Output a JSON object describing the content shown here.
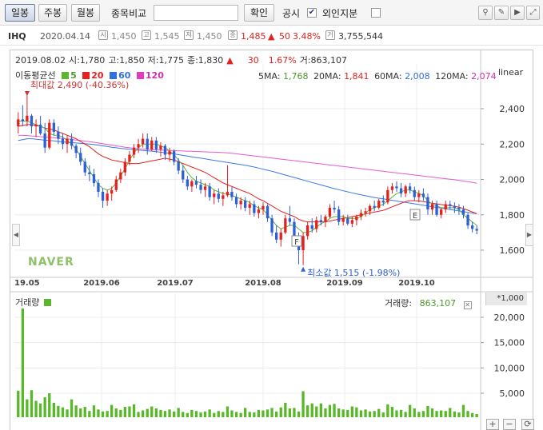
{
  "toolbar": {
    "period_buttons": [
      "일봉",
      "주봉",
      "월봉"
    ],
    "compare_label": "종목비교",
    "compare_input_value": "",
    "confirm_label": "확인",
    "disclosure_label": "공시",
    "disclosure_checked": "✔",
    "foreign_label": "외인지분",
    "icons": [
      "pin-icon",
      "pencil-icon",
      "cursor-icon",
      "expand-icon"
    ]
  },
  "info": {
    "ticker": "IHQ",
    "date": "2020.04.14",
    "open_label": "시",
    "open": "1,450",
    "high_label": "고",
    "high": "1,545",
    "low_label": "저",
    "low": "1,450",
    "close_label": "종",
    "close": "1,485",
    "change_arrow": "▲",
    "change": "50",
    "change_pct": "3.48%",
    "volume_label": "거",
    "volume": "3,755,544"
  },
  "chart": {
    "ohlc": {
      "date": "2019.08.02",
      "open": "시:1,780",
      "high": "고:1,850",
      "low": "저:1,775",
      "close": "종:1,830",
      "arrow": "▲",
      "change": "30",
      "pct": "1.67%",
      "volume": "거:863,107"
    },
    "legend_title": "이동평균선",
    "legend": [
      {
        "label": "5",
        "color": "#5cb531"
      },
      {
        "label": "20",
        "color": "#e5201f"
      },
      {
        "label": "60",
        "color": "#2f6fe0"
      },
      {
        "label": "120",
        "color": "#e03cc0"
      }
    ],
    "ma_info": [
      {
        "label": "5MA:",
        "value": "1,768",
        "color": "#4a9a2a"
      },
      {
        "label": "20MA:",
        "value": "1,841",
        "color": "#e5201f"
      },
      {
        "label": "60MA:",
        "value": "2,008",
        "color": "#2f6fe0"
      },
      {
        "label": "120MA:",
        "value": "2,074",
        "color": "#d02fb0"
      }
    ],
    "scale_label": "linear",
    "max_note": "최대값 2,490 (-40.36%)",
    "min_note": "최소값 1,515 (-1.98%)",
    "watermark": "NAVER",
    "marker_f": "F",
    "marker_e": "E",
    "y_ticks": [
      "2,400",
      "2,200",
      "2,000",
      "1,800",
      "1,600"
    ],
    "x_ticks": [
      "19.05",
      "2019.06",
      "2019.07",
      "2019.08",
      "2019.09",
      "2019.10"
    ],
    "volume_label": "거래량",
    "volume_value_label": "거래량:",
    "volume_value": "863,107",
    "volume_unit": "*1,000",
    "volume_ticks": [
      "20,000",
      "15,000",
      "10,000",
      "5,000"
    ]
  },
  "chart_data": {
    "type": "candlestick",
    "y_range": [
      1515,
      2490
    ],
    "candles": [
      [
        2300,
        2380,
        2260,
        2340
      ],
      [
        2340,
        2420,
        2300,
        2330
      ],
      [
        2330,
        2490,
        2300,
        2360
      ],
      [
        2360,
        2370,
        2260,
        2300
      ],
      [
        2300,
        2340,
        2240,
        2310
      ],
      [
        2310,
        2360,
        2250,
        2260
      ],
      [
        2260,
        2320,
        2150,
        2180
      ],
      [
        2180,
        2340,
        2170,
        2320
      ],
      [
        2320,
        2340,
        2250,
        2270
      ],
      [
        2270,
        2300,
        2200,
        2230
      ],
      [
        2230,
        2260,
        2170,
        2200
      ],
      [
        2200,
        2250,
        2150,
        2230
      ],
      [
        2230,
        2260,
        2170,
        2190
      ],
      [
        2190,
        2200,
        2120,
        2150
      ],
      [
        2150,
        2180,
        2080,
        2100
      ],
      [
        2100,
        2120,
        2020,
        2040
      ],
      [
        2040,
        2080,
        1990,
        2030
      ],
      [
        2030,
        2060,
        1960,
        1980
      ],
      [
        1980,
        2000,
        1900,
        1930
      ],
      [
        1930,
        1950,
        1840,
        1880
      ],
      [
        1880,
        1940,
        1850,
        1920
      ],
      [
        1920,
        1960,
        1880,
        1940
      ],
      [
        1940,
        2020,
        1930,
        2000
      ],
      [
        2000,
        2060,
        1980,
        2040
      ],
      [
        2040,
        2120,
        2020,
        2100
      ],
      [
        2100,
        2160,
        2080,
        2140
      ],
      [
        2140,
        2200,
        2120,
        2180
      ],
      [
        2180,
        2230,
        2150,
        2200
      ],
      [
        2200,
        2260,
        2180,
        2230
      ],
      [
        2230,
        2260,
        2140,
        2170
      ],
      [
        2170,
        2240,
        2160,
        2220
      ],
      [
        2220,
        2240,
        2150,
        2170
      ],
      [
        2170,
        2210,
        2130,
        2190
      ],
      [
        2190,
        2200,
        2110,
        2140
      ],
      [
        2140,
        2180,
        2100,
        2160
      ],
      [
        2160,
        2170,
        2080,
        2100
      ],
      [
        2100,
        2120,
        2030,
        2050
      ],
      [
        2050,
        2080,
        1980,
        2000
      ],
      [
        2000,
        2020,
        1940,
        1960
      ],
      [
        1960,
        2000,
        1930,
        1990
      ],
      [
        1990,
        2020,
        1950,
        1970
      ],
      [
        1970,
        2000,
        1920,
        1940
      ],
      [
        1940,
        1980,
        1900,
        1960
      ],
      [
        1960,
        1980,
        1880,
        1900
      ],
      [
        1900,
        1940,
        1860,
        1920
      ],
      [
        1920,
        1950,
        1870,
        1890
      ],
      [
        1890,
        1930,
        1850,
        1910
      ],
      [
        1910,
        2080,
        1900,
        1930
      ],
      [
        1930,
        1960,
        1880,
        1900
      ],
      [
        1900,
        1920,
        1840,
        1860
      ],
      [
        1860,
        1900,
        1830,
        1880
      ],
      [
        1880,
        1900,
        1820,
        1840
      ],
      [
        1840,
        1880,
        1800,
        1860
      ],
      [
        1860,
        1880,
        1790,
        1810
      ],
      [
        1810,
        1850,
        1780,
        1830
      ],
      [
        1830,
        1870,
        1800,
        1850
      ],
      [
        1850,
        1860,
        1760,
        1780
      ],
      [
        1780,
        1800,
        1680,
        1700
      ],
      [
        1700,
        1740,
        1640,
        1660
      ],
      [
        1660,
        1720,
        1620,
        1700
      ],
      [
        1700,
        1800,
        1690,
        1780
      ],
      [
        1780,
        1850,
        1740,
        1760
      ],
      [
        1760,
        1780,
        1640,
        1660
      ],
      [
        1660,
        1700,
        1520,
        1600
      ],
      [
        1600,
        1700,
        1515,
        1680
      ],
      [
        1680,
        1760,
        1660,
        1740
      ],
      [
        1740,
        1780,
        1700,
        1720
      ],
      [
        1720,
        1790,
        1700,
        1770
      ],
      [
        1770,
        1800,
        1740,
        1760
      ],
      [
        1760,
        1800,
        1730,
        1790
      ],
      [
        1790,
        1860,
        1780,
        1840
      ],
      [
        1840,
        1880,
        1810,
        1830
      ],
      [
        1830,
        1850,
        1740,
        1760
      ],
      [
        1760,
        1800,
        1740,
        1780
      ],
      [
        1780,
        1800,
        1740,
        1750
      ],
      [
        1750,
        1790,
        1730,
        1770
      ],
      [
        1770,
        1800,
        1740,
        1790
      ],
      [
        1790,
        1830,
        1770,
        1810
      ],
      [
        1810,
        1840,
        1790,
        1820
      ],
      [
        1820,
        1860,
        1800,
        1850
      ],
      [
        1850,
        1880,
        1820,
        1840
      ],
      [
        1840,
        1890,
        1830,
        1880
      ],
      [
        1880,
        1910,
        1850,
        1870
      ],
      [
        1870,
        1960,
        1860,
        1940
      ],
      [
        1940,
        1980,
        1920,
        1960
      ],
      [
        1960,
        1990,
        1930,
        1950
      ],
      [
        1950,
        1980,
        1900,
        1920
      ],
      [
        1920,
        1970,
        1900,
        1960
      ],
      [
        1960,
        1980,
        1920,
        1940
      ],
      [
        1940,
        1960,
        1880,
        1900
      ],
      [
        1900,
        1940,
        1870,
        1920
      ],
      [
        1920,
        1950,
        1880,
        1900
      ],
      [
        1900,
        1920,
        1800,
        1830
      ],
      [
        1830,
        1880,
        1800,
        1860
      ],
      [
        1860,
        1880,
        1790,
        1800
      ],
      [
        1800,
        1840,
        1780,
        1830
      ],
      [
        1830,
        1880,
        1810,
        1860
      ],
      [
        1860,
        1880,
        1830,
        1850
      ],
      [
        1850,
        1870,
        1810,
        1840
      ],
      [
        1840,
        1860,
        1800,
        1830
      ],
      [
        1830,
        1850,
        1780,
        1800
      ],
      [
        1800,
        1810,
        1720,
        1740
      ],
      [
        1740,
        1760,
        1700,
        1720
      ],
      [
        1720,
        1740,
        1690,
        1710
      ]
    ],
    "ma5": [
      2330,
      2330,
      2330,
      2320,
      2310,
      2300,
      2290,
      2260,
      2250,
      2250,
      2240,
      2220,
      2200,
      2170,
      2130,
      2090,
      2050,
      2010,
      1970,
      1950,
      1940,
      1950,
      1980,
      2020,
      2060,
      2110,
      2150,
      2180,
      2200,
      2200,
      2200,
      2200,
      2190,
      2180,
      2160,
      2140,
      2110,
      2080,
      2040,
      2010,
      1990,
      1980,
      1970,
      1960,
      1940,
      1930,
      1920,
      1920,
      1910,
      1900,
      1890,
      1880,
      1870,
      1850,
      1840,
      1830,
      1800,
      1770,
      1740,
      1720,
      1730,
      1740,
      1740,
      1720,
      1700,
      1700,
      1710,
      1730,
      1750,
      1760,
      1780,
      1790,
      1790,
      1790,
      1780,
      1780,
      1780,
      1790,
      1810,
      1830,
      1840,
      1850,
      1860,
      1880,
      1900,
      1920,
      1930,
      1940,
      1940,
      1930,
      1920,
      1910,
      1880,
      1860,
      1850,
      1840,
      1840,
      1840,
      1840,
      1830,
      1800,
      1780,
      1760,
      1740
    ],
    "ma20": [
      2300,
      2305,
      2310,
      2310,
      2305,
      2300,
      2290,
      2285,
      2280,
      2270,
      2260,
      2250,
      2240,
      2230,
      2215,
      2200,
      2185,
      2165,
      2145,
      2130,
      2120,
      2110,
      2105,
      2100,
      2095,
      2090,
      2090,
      2090,
      2095,
      2100,
      2105,
      2110,
      2115,
      2120,
      2115,
      2110,
      2100,
      2090,
      2080,
      2070,
      2060,
      2050,
      2040,
      2025,
      2010,
      1995,
      1980,
      1970,
      1960,
      1950,
      1940,
      1930,
      1920,
      1905,
      1890,
      1880,
      1865,
      1850,
      1835,
      1820,
      1810,
      1800,
      1790,
      1775,
      1765,
      1760,
      1760,
      1760,
      1760,
      1760,
      1765,
      1770,
      1775,
      1780,
      1785,
      1790,
      1795,
      1800,
      1805,
      1810,
      1815,
      1820,
      1825,
      1835,
      1845,
      1855,
      1865,
      1875,
      1880,
      1880,
      1878,
      1875,
      1870,
      1865,
      1862,
      1858,
      1855,
      1852,
      1848,
      1843,
      1835,
      1826,
      1816,
      1806
    ],
    "ma60": [
      2220,
      2225,
      2230,
      2230,
      2228,
      2225,
      2222,
      2220,
      2218,
      2215,
      2212,
      2210,
      2208,
      2206,
      2204,
      2202,
      2200,
      2197,
      2194,
      2190,
      2186,
      2182,
      2179,
      2176,
      2173,
      2170,
      2168,
      2166,
      2164,
      2162,
      2160,
      2157,
      2154,
      2151,
      2148,
      2144,
      2140,
      2136,
      2132,
      2128,
      2124,
      2120,
      2116,
      2112,
      2108,
      2104,
      2100,
      2096,
      2092,
      2088,
      2084,
      2080,
      2075,
      2070,
      2064,
      2058,
      2052,
      2046,
      2039,
      2032,
      2025,
      2018,
      2011,
      2004,
      1997,
      1990,
      1983,
      1976,
      1969,
      1962,
      1955,
      1948,
      1942,
      1936,
      1930,
      1924,
      1918,
      1913,
      1908,
      1903,
      1898,
      1894,
      1890,
      1886,
      1882,
      1878,
      1874,
      1870,
      1866,
      1862,
      1858,
      1854,
      1850,
      1846,
      1842,
      1838,
      1834,
      1830,
      1826,
      1822,
      1818,
      1814,
      1810,
      1806
    ],
    "ma120": [
      2250,
      2249,
      2248,
      2246,
      2244,
      2242,
      2240,
      2238,
      2236,
      2234,
      2232,
      2229,
      2226,
      2223,
      2220,
      2217,
      2214,
      2210,
      2206,
      2202,
      2198,
      2194,
      2190,
      2186,
      2182,
      2179,
      2176,
      2174,
      2172,
      2170,
      2168,
      2167,
      2166,
      2165,
      2164,
      2163,
      2162,
      2161,
      2160,
      2159,
      2158,
      2157,
      2156,
      2155,
      2154,
      2153,
      2152,
      2150,
      2148,
      2145,
      2142,
      2139,
      2136,
      2133,
      2130,
      2127,
      2124,
      2121,
      2118,
      2115,
      2112,
      2109,
      2106,
      2103,
      2100,
      2097,
      2094,
      2091,
      2088,
      2085,
      2082,
      2079,
      2076,
      2073,
      2070,
      2067,
      2064,
      2061,
      2058,
      2055,
      2052,
      2049,
      2046,
      2043,
      2040,
      2037,
      2034,
      2031,
      2028,
      2025,
      2022,
      2019,
      2016,
      2013,
      2010,
      2007,
      2004,
      2001,
      1998,
      1995,
      1991,
      1987,
      1983,
      1979
    ],
    "volumes": [
      5500,
      22000,
      3800,
      5600,
      3500,
      3000,
      4200,
      5000,
      3100,
      2500,
      2200,
      1800,
      3800,
      2600,
      2000,
      2300,
      1500,
      2600,
      1800,
      1400,
      1500,
      2700,
      2000,
      1700,
      2300,
      2400,
      2800,
      1300,
      1600,
      1900,
      2400,
      2000,
      1700,
      1500,
      1800,
      1400,
      2100,
      1300,
      1100,
      1700,
      1500,
      1200,
      1400,
      1800,
      1100,
      1500,
      1300,
      2400,
      1600,
      1300,
      1100,
      2100,
      1300,
      1200,
      1700,
      1600,
      1800,
      2100,
      1400,
      2200,
      3100,
      2000,
      2100,
      1400,
      5400,
      2600,
      3000,
      2400,
      3000,
      2000,
      2700,
      2900,
      2000,
      1800,
      1700,
      2400,
      2200,
      1600,
      1800,
      1400,
      1500,
      1900,
      1200,
      2800,
      2300,
      1600,
      1700,
      1300,
      2700,
      2000,
      1300,
      1500,
      2500,
      2000,
      1500,
      1600,
      1500,
      2100,
      1400,
      1200,
      2700,
      1500,
      1100,
      900
    ],
    "vol_range": [
      0,
      22000
    ]
  }
}
